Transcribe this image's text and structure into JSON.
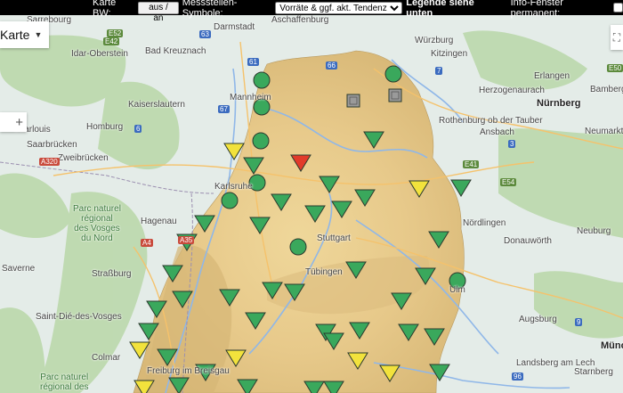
{
  "toolbar": {
    "karte_label": "Karte BW:",
    "karte_button": "aus / an",
    "symbol_label": "Messstellen-Symbole:",
    "symbol_selected": "Vorräte & ggf. akt. Tendenz",
    "legend_label": "Legende siehe unten",
    "info_label": "Info-Fenster permanent:"
  },
  "map": {
    "type_label": "Karte",
    "cities": [
      {
        "name": "Darmstadt"
      },
      {
        "name": "Aschaffenburg"
      },
      {
        "name": "Würzburg"
      },
      {
        "name": "Kitzingen"
      },
      {
        "name": "Bad Kreuznach"
      },
      {
        "name": "Idar-Oberstein"
      },
      {
        "name": "Kaiserslautern"
      },
      {
        "name": "Homburg"
      },
      {
        "name": "Saarlouis"
      },
      {
        "name": "Saarbrücken"
      },
      {
        "name": "Zweibrücken"
      },
      {
        "name": "Erlangen"
      },
      {
        "name": "Herzogenaurach"
      },
      {
        "name": "Nürnberg"
      },
      {
        "name": "Ansbach"
      },
      {
        "name": "Neumarkt in der Oberpfalz"
      },
      {
        "name": "Hagenau"
      },
      {
        "name": "Straßburg"
      },
      {
        "name": "Saint-Dié-des-Vosges"
      },
      {
        "name": "Colmar"
      },
      {
        "name": "Augsburg"
      },
      {
        "name": "Donauwörth"
      },
      {
        "name": "Landsberg am Lech"
      },
      {
        "name": "Starnberg"
      },
      {
        "name": "München"
      },
      {
        "name": "Stuttgart"
      },
      {
        "name": "Tübingen"
      },
      {
        "name": "Freiburg im Breisgau"
      },
      {
        "name": "Rothenburg ob der Tauber"
      },
      {
        "name": "Mannheim"
      },
      {
        "name": "Karlsruhe"
      },
      {
        "name": "Ulm"
      },
      {
        "name": "Bamberg"
      },
      {
        "name": "Nördlingen"
      },
      {
        "name": "Neuburg"
      },
      {
        "name": "Saverne"
      },
      {
        "name": "Sarrebourg"
      }
    ],
    "parks": [
      {
        "name": "Parc naturel\nrégional\ndes Vosges\ndu Nord"
      },
      {
        "name": "Parc naturel\nrégional des"
      }
    ],
    "roads": [
      "A320",
      "A4",
      "A35",
      "E42",
      "61",
      "67",
      "63",
      "66",
      "6",
      "7",
      "3",
      "9",
      "96",
      "E50",
      "E52",
      "E54",
      "E41"
    ]
  },
  "stations": {
    "colors": {
      "green": "#3aa85c",
      "yellow": "#f2e23c",
      "red": "#e23a2a",
      "grey": "#9a9a9a"
    },
    "legend": {
      "down": "falling",
      "up": "rising",
      "circle": "normal",
      "square": "no data"
    }
  },
  "icons": [
    "fullscreen-icon",
    "caret-down-icon",
    "plus-icon"
  ]
}
